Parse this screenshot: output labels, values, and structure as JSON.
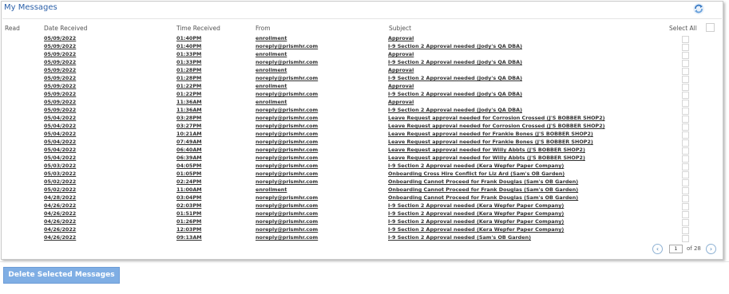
{
  "title": "My Messages",
  "columns": {
    "read": "Read",
    "date": "Date Received",
    "time": "Time Received",
    "from": "From",
    "subject": "Subject",
    "select_all": "Select All"
  },
  "messages": [
    {
      "date": "05/09/2022",
      "time": "01:40PM",
      "from": "enrollment",
      "subject": "Approval"
    },
    {
      "date": "05/09/2022",
      "time": "01:40PM",
      "from": "noreply@prismhr.com",
      "subject": "I-9 Section 2 Approval needed (Jody's QA DBA)"
    },
    {
      "date": "05/09/2022",
      "time": "01:33PM",
      "from": "enrollment",
      "subject": "Approval"
    },
    {
      "date": "05/09/2022",
      "time": "01:33PM",
      "from": "noreply@prismhr.com",
      "subject": "I-9 Section 2 Approval needed (Jody's QA DBA)"
    },
    {
      "date": "05/09/2022",
      "time": "01:28PM",
      "from": "enrollment",
      "subject": "Approval"
    },
    {
      "date": "05/09/2022",
      "time": "01:28PM",
      "from": "noreply@prismhr.com",
      "subject": "I-9 Section 2 Approval needed (Jody's QA DBA)"
    },
    {
      "date": "05/09/2022",
      "time": "01:22PM",
      "from": "enrollment",
      "subject": "Approval"
    },
    {
      "date": "05/09/2022",
      "time": "01:22PM",
      "from": "noreply@prismhr.com",
      "subject": "I-9 Section 2 Approval needed (Jody's QA DBA)"
    },
    {
      "date": "05/09/2022",
      "time": "11:36AM",
      "from": "enrollment",
      "subject": "Approval"
    },
    {
      "date": "05/09/2022",
      "time": "11:36AM",
      "from": "noreply@prismhr.com",
      "subject": "I-9 Section 2 Approval needed (Jody's QA DBA)"
    },
    {
      "date": "05/04/2022",
      "time": "03:28PM",
      "from": "noreply@prismhr.com",
      "subject": "Leave Request approval needed for Corrosion Crossed (J'S BOBBER SHOP2)"
    },
    {
      "date": "05/04/2022",
      "time": "03:27PM",
      "from": "noreply@prismhr.com",
      "subject": "Leave Request approval needed for Corrosion Crossed (J'S BOBBER SHOP2)"
    },
    {
      "date": "05/04/2022",
      "time": "10:21AM",
      "from": "noreply@prismhr.com",
      "subject": "Leave Request approval needed for Frankie Bones (J'S BOBBER SHOP2)"
    },
    {
      "date": "05/04/2022",
      "time": "07:49AM",
      "from": "noreply@prismhr.com",
      "subject": "Leave Request approval needed for Frankie Bones (J'S BOBBER SHOP2)"
    },
    {
      "date": "05/04/2022",
      "time": "06:40AM",
      "from": "noreply@prismhr.com",
      "subject": "Leave Request approval needed for Willy Abbts (J'S BOBBER SHOP2)"
    },
    {
      "date": "05/04/2022",
      "time": "06:39AM",
      "from": "noreply@prismhr.com",
      "subject": "Leave Request approval needed for Willy Abbts (J'S BOBBER SHOP2)"
    },
    {
      "date": "05/03/2022",
      "time": "04:05PM",
      "from": "noreply@prismhr.com",
      "subject": "I-9 Section 2 Approval needed (Kera Wepfer Paper Company)"
    },
    {
      "date": "05/03/2022",
      "time": "01:05PM",
      "from": "noreply@prismhr.com",
      "subject": "Onboarding Cross Hire Conflict for Liz Ard (Sam's OB Garden)"
    },
    {
      "date": "05/02/2022",
      "time": "02:24PM",
      "from": "noreply@prismhr.com",
      "subject": "Onboarding Cannot Proceed for Frank Douglas (Sam's OB Garden)"
    },
    {
      "date": "05/02/2022",
      "time": "11:00AM",
      "from": "enrollment",
      "subject": "Onboarding Cannot Proceed for Frank Douglas (Sam's OB Garden)"
    },
    {
      "date": "04/28/2022",
      "time": "03:04PM",
      "from": "noreply@prismhr.com",
      "subject": "Onboarding Cannot Proceed for Frank Douglas (Sam's OB Garden)"
    },
    {
      "date": "04/26/2022",
      "time": "02:03PM",
      "from": "noreply@prismhr.com",
      "subject": "I-9 Section 2 Approval needed (Kera Wepfer Paper Company)"
    },
    {
      "date": "04/26/2022",
      "time": "01:51PM",
      "from": "noreply@prismhr.com",
      "subject": "I-9 Section 2 Approval needed (Kera Wepfer Paper Company)"
    },
    {
      "date": "04/26/2022",
      "time": "01:26PM",
      "from": "noreply@prismhr.com",
      "subject": "I-9 Section 2 Approval needed (Kera Wepfer Paper Company)"
    },
    {
      "date": "04/26/2022",
      "time": "12:03PM",
      "from": "noreply@prismhr.com",
      "subject": "I-9 Section 2 Approval needed (Kera Wepfer Paper Company)"
    },
    {
      "date": "04/26/2022",
      "time": "09:13AM",
      "from": "noreply@prismhr.com",
      "subject": "I-9 Section 2 Approval needed (Sam's OB Garden)"
    }
  ],
  "pager": {
    "page": "1",
    "of_label": "of 28",
    "prev_icon": "chevron-left-icon",
    "next_icon": "chevron-right-icon"
  },
  "actions": {
    "delete_label": "Delete Selected Messages"
  },
  "colors": {
    "title": "#2a5fa8",
    "button": "#7faee4"
  },
  "icons": {
    "refresh": "refresh-icon"
  }
}
